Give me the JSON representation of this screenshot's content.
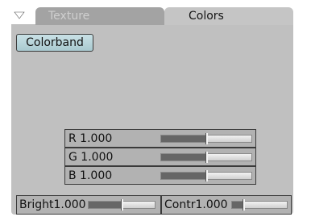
{
  "tabs": {
    "texture_label": "Texture",
    "colors_label": "Colors",
    "active": "Colors"
  },
  "colorband_label": "Colorband",
  "rgb": [
    {
      "label": "R 1.000",
      "value": 1.0,
      "max": 2.0
    },
    {
      "label": "G 1.000",
      "value": 1.0,
      "max": 2.0
    },
    {
      "label": "B 1.000",
      "value": 1.0,
      "max": 2.0
    }
  ],
  "bright": {
    "label": "Bright1.000",
    "value": 1.0,
    "max": 2.0
  },
  "contr": {
    "label": "Contr1.000",
    "value": 1.0,
    "max": 5.0
  },
  "colors": {
    "panel_bg": "#c0c0c0",
    "active_tab_bg": "#c5c5c5",
    "inactive_tab_bg": "#a3a3a3",
    "button_bg": "#b9d6dc",
    "slider_fill": "#666666"
  }
}
